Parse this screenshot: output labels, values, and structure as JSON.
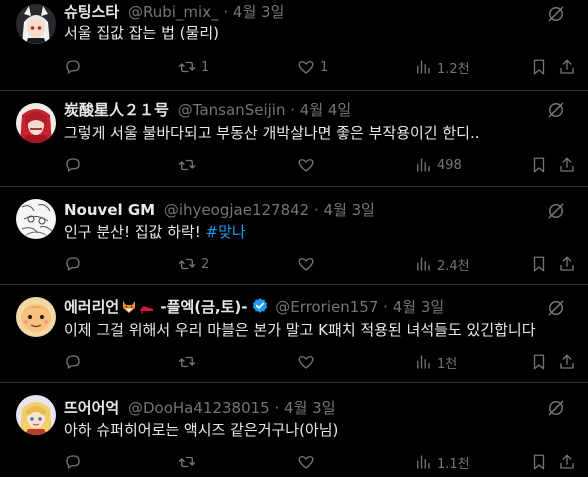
{
  "theme": {
    "background": "#000000",
    "text": "#e7e9ea",
    "muted": "#71767b",
    "accent": "#1d9bf0",
    "divider": "#2f3336"
  },
  "tweets": [
    {
      "name": "슈팅스타",
      "handle": "@Rubi_mix_",
      "time": "4월 3일",
      "text": "서울 집값 잡는 법 (물리)",
      "replies": "",
      "retweets": "1",
      "likes": "1",
      "views": "1.2천",
      "avatar_icon": "white-haired-anime-girl-avatar"
    },
    {
      "name": "炭酸星人２１号",
      "handle": "@TansanSeijin",
      "time": "4월 4일",
      "text": "그렇게 서울 불바다되고 부동산 개박살나면 좋은 부작용이긴 한디..",
      "replies": "",
      "retweets": "",
      "likes": "",
      "views": "498",
      "avatar_icon": "red-anime-character-avatar"
    },
    {
      "name": "Nouvel GM",
      "handle": "@ihyeogjae127842",
      "time": "4월 3일",
      "text": "인구 분산! 집값 하락! ",
      "hashtag": "#맞나",
      "replies": "",
      "retweets": "2",
      "likes": "",
      "views": "2.4천",
      "avatar_icon": "sketch-drawing-avatar"
    },
    {
      "name": "에러리언",
      "name_suffix": " -플엑(금,토)-",
      "handle": "@Errorien157",
      "time": "4월 3일",
      "text": "이제 그걸 위해서 우리 마블은 본가 말고 K패치 적용된 녀석들도 있긴합니다",
      "replies": "",
      "retweets": "",
      "likes": "",
      "views": "1천",
      "verified": true,
      "name_emojis": [
        "fox-face-emoji",
        "high-heel-emoji"
      ],
      "avatar_icon": "cartoon-face-avatar"
    },
    {
      "name": "뜨어어억",
      "handle": "@DooHa41238015",
      "time": "4월 3일",
      "text": "아하 슈퍼히어로는 액시즈 같은거구나(아님)",
      "replies": "",
      "retweets": "",
      "likes": "",
      "views": "1.1천",
      "avatar_icon": "blonde-anime-character-avatar"
    }
  ]
}
